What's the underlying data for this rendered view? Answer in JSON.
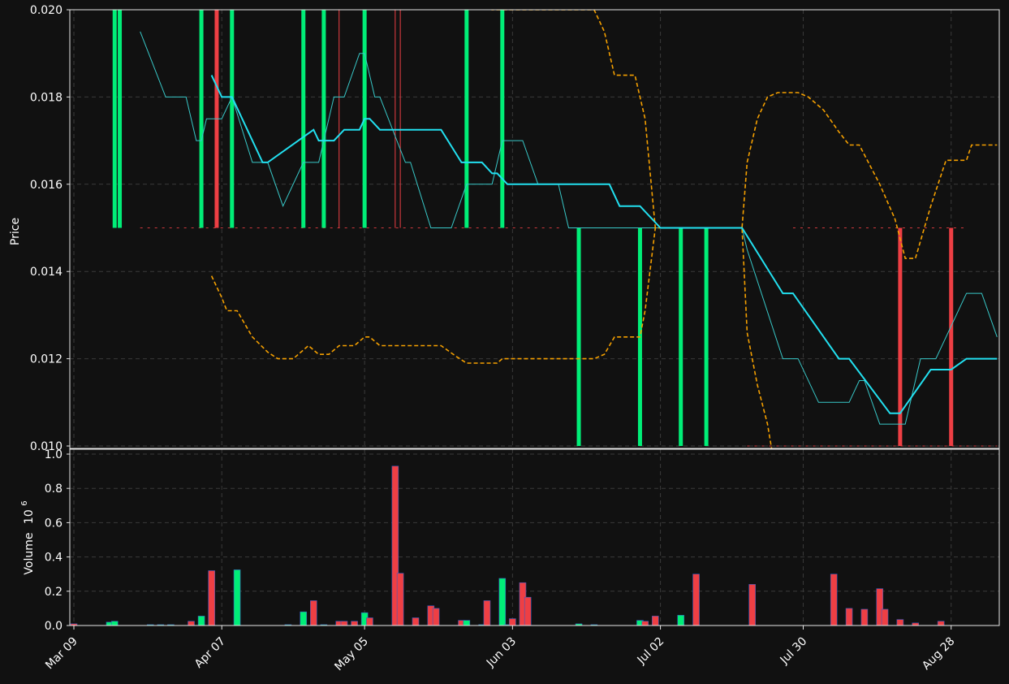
{
  "colors": {
    "background": "#111111",
    "up": "#00ee77",
    "down": "#ee3f44",
    "ma": "#22e0f0",
    "close": "#38c8c8",
    "envelope": "#f5a000",
    "grid": "#3a3a3a"
  },
  "chart_data": [
    {
      "type": "ohlc-candlestick",
      "panel": "price",
      "ylabel": "Price",
      "ylim": [
        0.01,
        0.02
      ],
      "y_ticks": [
        "0.010",
        "0.012",
        "0.014",
        "0.016",
        "0.018",
        "0.020"
      ],
      "grid": true,
      "x_ticks": [
        "Mar 09",
        "Apr 07",
        "May 05",
        "Jun 03",
        "Jul 02",
        "Jul 30",
        "Aug 28"
      ],
      "candles": [
        {
          "date": "2023-03-17",
          "open": 0.015,
          "high": 0.02,
          "low": 0.015,
          "close": 0.02
        },
        {
          "date": "2023-03-18",
          "open": 0.015,
          "high": 0.02,
          "low": 0.015,
          "close": 0.02
        },
        {
          "date": "2023-04-03",
          "open": 0.015,
          "high": 0.02,
          "low": 0.015,
          "close": 0.02
        },
        {
          "date": "2023-04-06",
          "open": 0.02,
          "high": 0.02,
          "low": 0.015,
          "close": 0.015
        },
        {
          "date": "2023-04-09",
          "open": 0.015,
          "high": 0.02,
          "low": 0.015,
          "close": 0.02
        },
        {
          "date": "2023-04-23",
          "open": 0.015,
          "high": 0.02,
          "low": 0.015,
          "close": 0.02
        },
        {
          "date": "2023-04-27",
          "open": 0.015,
          "high": 0.02,
          "low": 0.015,
          "close": 0.02
        },
        {
          "date": "2023-05-05",
          "open": 0.015,
          "high": 0.02,
          "low": 0.015,
          "close": 0.02
        },
        {
          "date": "2023-05-25",
          "open": 0.015,
          "high": 0.02,
          "low": 0.015,
          "close": 0.02
        },
        {
          "date": "2023-06-01",
          "open": 0.015,
          "high": 0.02,
          "low": 0.015,
          "close": 0.02
        },
        {
          "date": "2023-06-16",
          "open": 0.01,
          "high": 0.015,
          "low": 0.01,
          "close": 0.015
        },
        {
          "date": "2023-06-28",
          "open": 0.01,
          "high": 0.015,
          "low": 0.01,
          "close": 0.015
        },
        {
          "date": "2023-07-06",
          "open": 0.01,
          "high": 0.015,
          "low": 0.01,
          "close": 0.015
        },
        {
          "date": "2023-07-11",
          "open": 0.01,
          "high": 0.015,
          "low": 0.01,
          "close": 0.015
        },
        {
          "date": "2023-08-18",
          "open": 0.015,
          "high": 0.015,
          "low": 0.01,
          "close": 0.01
        },
        {
          "date": "2023-08-28",
          "open": 0.015,
          "high": 0.015,
          "low": 0.01,
          "close": 0.01
        }
      ],
      "thin_lines": [
        {
          "date": "2023-04-30",
          "color": "down"
        },
        {
          "date": "2023-05-11",
          "color": "down"
        },
        {
          "date": "2023-05-12",
          "color": "down"
        }
      ],
      "close_line": [
        [
          "2023-03-22",
          0.0195
        ],
        [
          "2023-03-27",
          0.018
        ],
        [
          "2023-03-31",
          0.018
        ],
        [
          "2023-04-02",
          0.017
        ],
        [
          "2023-04-03",
          0.017
        ],
        [
          "2023-04-04",
          0.0175
        ],
        [
          "2023-04-07",
          0.0175
        ],
        [
          "2023-04-09",
          0.018
        ],
        [
          "2023-04-13",
          0.0165
        ],
        [
          "2023-04-16",
          0.0165
        ],
        [
          "2023-04-19",
          0.0155
        ],
        [
          "2023-04-23",
          0.0165
        ],
        [
          "2023-04-26",
          0.0165
        ],
        [
          "2023-04-29",
          0.018
        ],
        [
          "2023-05-01",
          0.018
        ],
        [
          "2023-05-04",
          0.019
        ],
        [
          "2023-05-05",
          0.019
        ],
        [
          "2023-05-07",
          0.018
        ],
        [
          "2023-05-08",
          0.018
        ],
        [
          "2023-05-13",
          0.0165
        ],
        [
          "2023-05-14",
          0.0165
        ],
        [
          "2023-05-18",
          0.015
        ],
        [
          "2023-05-22",
          0.015
        ],
        [
          "2023-05-25",
          0.016
        ],
        [
          "2023-05-30",
          0.016
        ],
        [
          "2023-06-01",
          0.017
        ],
        [
          "2023-06-05",
          0.017
        ],
        [
          "2023-06-08",
          0.016
        ],
        [
          "2023-06-12",
          0.016
        ],
        [
          "2023-06-14",
          0.015
        ],
        [
          "2023-07-18",
          0.015
        ],
        [
          "2023-07-19",
          0.0145
        ],
        [
          "2023-07-26",
          0.012
        ],
        [
          "2023-07-29",
          0.012
        ],
        [
          "2023-08-02",
          0.011
        ],
        [
          "2023-08-08",
          0.011
        ],
        [
          "2023-08-10",
          0.0115
        ],
        [
          "2023-08-11",
          0.0115
        ],
        [
          "2023-08-14",
          0.0105
        ],
        [
          "2023-08-19",
          0.0105
        ],
        [
          "2023-08-22",
          0.012
        ],
        [
          "2023-08-25",
          0.012
        ],
        [
          "2023-08-31",
          0.0135
        ],
        [
          "2023-09-03",
          0.0135
        ],
        [
          "2023-09-06",
          0.0125
        ]
      ],
      "ma_line": [
        [
          "2023-04-05",
          0.0185
        ],
        [
          "2023-04-07",
          0.018
        ],
        [
          "2023-04-09",
          0.018
        ],
        [
          "2023-04-15",
          0.0165
        ],
        [
          "2023-04-16",
          0.0165
        ],
        [
          "2023-04-25",
          0.01725
        ],
        [
          "2023-04-26",
          0.017
        ],
        [
          "2023-04-29",
          0.017
        ],
        [
          "2023-05-01",
          0.01725
        ],
        [
          "2023-05-04",
          0.01725
        ],
        [
          "2023-05-05",
          0.0175
        ],
        [
          "2023-05-06",
          0.0175
        ],
        [
          "2023-05-08",
          0.01725
        ],
        [
          "2023-05-20",
          0.01725
        ],
        [
          "2023-05-24",
          0.0165
        ],
        [
          "2023-05-28",
          0.0165
        ],
        [
          "2023-05-30",
          0.01625
        ],
        [
          "2023-05-31",
          0.01625
        ],
        [
          "2023-06-02",
          0.016
        ],
        [
          "2023-06-22",
          0.016
        ],
        [
          "2023-06-24",
          0.0155
        ],
        [
          "2023-06-28",
          0.0155
        ],
        [
          "2023-07-02",
          0.015
        ],
        [
          "2023-07-18",
          0.015
        ],
        [
          "2023-07-26",
          0.0135
        ],
        [
          "2023-07-28",
          0.0135
        ],
        [
          "2023-08-06",
          0.012
        ],
        [
          "2023-08-08",
          0.012
        ],
        [
          "2023-08-16",
          0.01075
        ],
        [
          "2023-08-18",
          0.01075
        ],
        [
          "2023-08-24",
          0.01175
        ],
        [
          "2023-08-28",
          0.01175
        ],
        [
          "2023-08-31",
          0.012
        ],
        [
          "2023-09-06",
          0.012
        ]
      ],
      "envelope_upper": [
        [
          "2023-05-30",
          0.0202
        ],
        [
          "2023-05-30",
          0.02
        ],
        [
          "2023-06-19",
          0.02
        ],
        [
          "2023-06-21",
          0.0195
        ],
        [
          "2023-06-23",
          0.0185
        ],
        [
          "2023-06-27",
          0.0185
        ],
        [
          "2023-06-28",
          0.018
        ],
        [
          "2023-06-29",
          0.0175
        ],
        [
          "2023-07-01",
          0.015
        ],
        [
          "2023-07-18",
          0.015
        ],
        [
          "2023-07-19",
          0.0165
        ],
        [
          "2023-07-20",
          0.017
        ],
        [
          "2023-07-21",
          0.0175
        ],
        [
          "2023-07-23",
          0.018
        ],
        [
          "2023-07-25",
          0.0181
        ],
        [
          "2023-07-29",
          0.0181
        ],
        [
          "2023-07-31",
          0.018
        ],
        [
          "2023-08-03",
          0.0177
        ],
        [
          "2023-08-06",
          0.0172
        ],
        [
          "2023-08-08",
          0.0169
        ],
        [
          "2023-08-10",
          0.0169
        ],
        [
          "2023-08-14",
          0.016
        ],
        [
          "2023-08-17",
          0.0152
        ],
        [
          "2023-08-19",
          0.0143
        ],
        [
          "2023-08-21",
          0.0143
        ],
        [
          "2023-08-24",
          0.0155
        ],
        [
          "2023-08-27",
          0.01655
        ],
        [
          "2023-08-29",
          0.01655
        ],
        [
          "2023-08-31",
          0.01655
        ],
        [
          "2023-09-01",
          0.0169
        ],
        [
          "2023-09-06",
          0.0169
        ]
      ],
      "envelope_lower": [
        [
          "2023-04-05",
          0.0139
        ],
        [
          "2023-04-07",
          0.0134
        ],
        [
          "2023-04-08",
          0.0131
        ],
        [
          "2023-04-10",
          0.0131
        ],
        [
          "2023-04-13",
          0.0125
        ],
        [
          "2023-04-16",
          0.01215
        ],
        [
          "2023-04-18",
          0.012
        ],
        [
          "2023-04-21",
          0.012
        ],
        [
          "2023-04-24",
          0.0123
        ],
        [
          "2023-04-26",
          0.0121
        ],
        [
          "2023-04-28",
          0.0121
        ],
        [
          "2023-04-30",
          0.0123
        ],
        [
          "2023-05-03",
          0.0123
        ],
        [
          "2023-05-05",
          0.0125
        ],
        [
          "2023-05-06",
          0.0125
        ],
        [
          "2023-05-08",
          0.0123
        ],
        [
          "2023-05-20",
          0.0123
        ],
        [
          "2023-05-23",
          0.01205
        ],
        [
          "2023-05-25",
          0.0119
        ],
        [
          "2023-05-31",
          0.0119
        ],
        [
          "2023-06-01",
          0.012
        ],
        [
          "2023-06-19",
          0.012
        ],
        [
          "2023-06-21",
          0.0121
        ],
        [
          "2023-06-23",
          0.0125
        ],
        [
          "2023-06-26",
          0.0125
        ],
        [
          "2023-06-28",
          0.0125
        ],
        [
          "2023-06-29",
          0.0131
        ],
        [
          "2023-07-01",
          0.015
        ],
        [
          "2023-07-18",
          0.015
        ],
        [
          "2023-07-19",
          0.0126
        ],
        [
          "2023-07-21",
          0.0114
        ],
        [
          "2023-07-23",
          0.0105
        ],
        [
          "2023-07-24",
          0.0098
        ]
      ],
      "trace_dashes": [
        {
          "price": 0.02,
          "from": "2023-03-09",
          "to": "2023-05-30",
          "color": "down"
        },
        {
          "price": 0.015,
          "from": "2023-03-22",
          "to": "2023-06-13",
          "color": "down"
        },
        {
          "price": 0.015,
          "from": "2023-07-28",
          "to": "2023-08-31",
          "color": "down"
        },
        {
          "price": 0.01,
          "from": "2023-07-19",
          "to": "2023-09-06",
          "color": "down"
        }
      ]
    },
    {
      "type": "bar",
      "panel": "volume",
      "ylabel": "Volume",
      "ylabel_exponent": "10",
      "ylabel_exponent_power": "6",
      "ylim": [
        0,
        1.0
      ],
      "y_ticks": [
        "0.0",
        "0.2",
        "0.4",
        "0.6",
        "0.8",
        "1.0"
      ],
      "grid": true,
      "bars": [
        {
          "date": "2023-03-09",
          "value": 0.01,
          "color": "down"
        },
        {
          "date": "2023-03-16",
          "value": 0.02,
          "color": "up"
        },
        {
          "date": "2023-03-17",
          "value": 0.025,
          "color": "up"
        },
        {
          "date": "2023-03-24",
          "value": 0.005,
          "color": "up"
        },
        {
          "date": "2023-03-26",
          "value": 0.005,
          "color": "up"
        },
        {
          "date": "2023-03-28",
          "value": 0.005,
          "color": "up"
        },
        {
          "date": "2023-04-01",
          "value": 0.025,
          "color": "down"
        },
        {
          "date": "2023-04-03",
          "value": 0.055,
          "color": "up"
        },
        {
          "date": "2023-04-05",
          "value": 0.32,
          "color": "down"
        },
        {
          "date": "2023-04-10",
          "value": 0.325,
          "color": "up"
        },
        {
          "date": "2023-04-20",
          "value": 0.005,
          "color": "up"
        },
        {
          "date": "2023-04-23",
          "value": 0.08,
          "color": "up"
        },
        {
          "date": "2023-04-25",
          "value": 0.145,
          "color": "down"
        },
        {
          "date": "2023-04-27",
          "value": 0.005,
          "color": "up"
        },
        {
          "date": "2023-04-30",
          "value": 0.025,
          "color": "down"
        },
        {
          "date": "2023-05-01",
          "value": 0.025,
          "color": "down"
        },
        {
          "date": "2023-05-03",
          "value": 0.025,
          "color": "down"
        },
        {
          "date": "2023-05-05",
          "value": 0.075,
          "color": "up"
        },
        {
          "date": "2023-05-06",
          "value": 0.045,
          "color": "down"
        },
        {
          "date": "2023-05-11",
          "value": 0.93,
          "color": "down"
        },
        {
          "date": "2023-05-12",
          "value": 0.305,
          "color": "down"
        },
        {
          "date": "2023-05-15",
          "value": 0.045,
          "color": "down"
        },
        {
          "date": "2023-05-18",
          "value": 0.115,
          "color": "down"
        },
        {
          "date": "2023-05-19",
          "value": 0.1,
          "color": "down"
        },
        {
          "date": "2023-05-24",
          "value": 0.03,
          "color": "down"
        },
        {
          "date": "2023-05-25",
          "value": 0.03,
          "color": "up"
        },
        {
          "date": "2023-05-28",
          "value": 0.005,
          "color": "up"
        },
        {
          "date": "2023-05-29",
          "value": 0.145,
          "color": "down"
        },
        {
          "date": "2023-06-01",
          "value": 0.275,
          "color": "up"
        },
        {
          "date": "2023-06-02",
          "value": 0.005,
          "color": "up"
        },
        {
          "date": "2023-06-03",
          "value": 0.04,
          "color": "down"
        },
        {
          "date": "2023-06-05",
          "value": 0.25,
          "color": "down"
        },
        {
          "date": "2023-06-06",
          "value": 0.165,
          "color": "down"
        },
        {
          "date": "2023-06-16",
          "value": 0.01,
          "color": "up"
        },
        {
          "date": "2023-06-19",
          "value": 0.005,
          "color": "up"
        },
        {
          "date": "2023-06-28",
          "value": 0.03,
          "color": "up"
        },
        {
          "date": "2023-06-29",
          "value": 0.025,
          "color": "down"
        },
        {
          "date": "2023-07-01",
          "value": 0.055,
          "color": "down"
        },
        {
          "date": "2023-07-06",
          "value": 0.06,
          "color": "up"
        },
        {
          "date": "2023-07-09",
          "value": 0.3,
          "color": "down"
        },
        {
          "date": "2023-07-20",
          "value": 0.24,
          "color": "down"
        },
        {
          "date": "2023-08-05",
          "value": 0.3,
          "color": "down"
        },
        {
          "date": "2023-08-08",
          "value": 0.1,
          "color": "down"
        },
        {
          "date": "2023-08-11",
          "value": 0.095,
          "color": "down"
        },
        {
          "date": "2023-08-14",
          "value": 0.215,
          "color": "down"
        },
        {
          "date": "2023-08-15",
          "value": 0.095,
          "color": "down"
        },
        {
          "date": "2023-08-18",
          "value": 0.035,
          "color": "down"
        },
        {
          "date": "2023-08-21",
          "value": 0.015,
          "color": "down"
        },
        {
          "date": "2023-08-26",
          "value": 0.025,
          "color": "down"
        }
      ]
    }
  ]
}
